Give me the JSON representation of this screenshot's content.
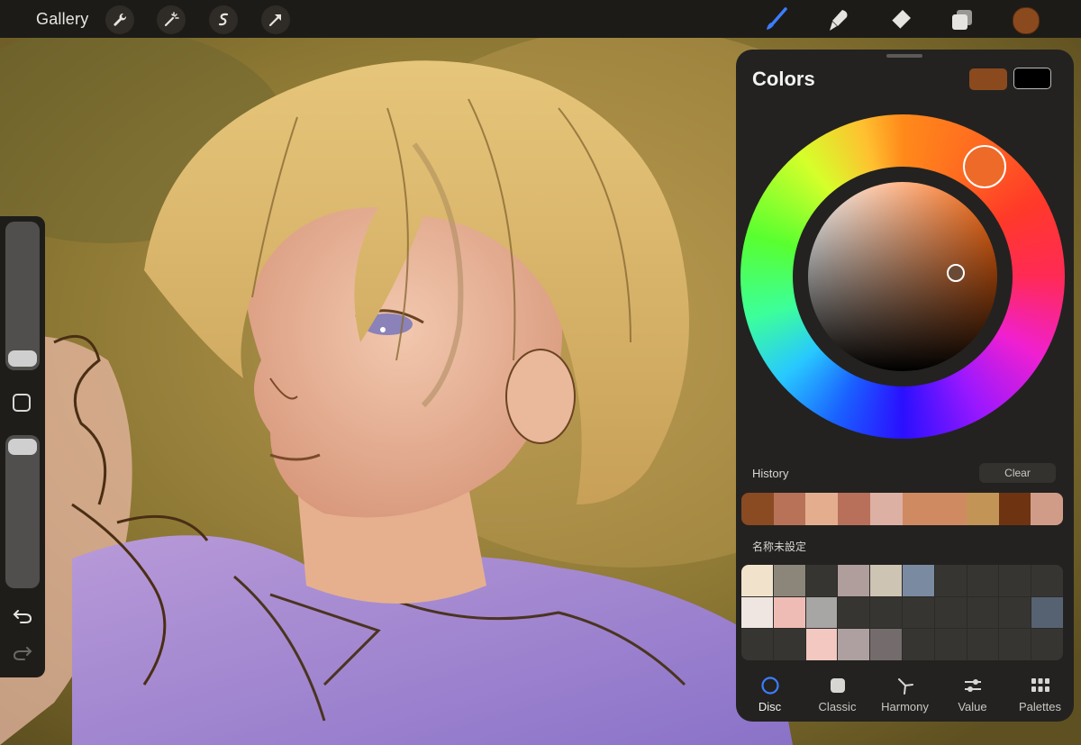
{
  "app": {
    "gallery_label": "Gallery"
  },
  "toolbar": {
    "left_tools": [
      "wrench-icon",
      "magic-wand-icon",
      "selection-s-icon",
      "transform-arrow-icon"
    ],
    "right_tools": [
      "brush-icon",
      "smudge-icon",
      "eraser-icon",
      "layers-icon"
    ],
    "current_color": "#8b4a1e"
  },
  "panel": {
    "title": "Colors",
    "primary_color": "#8b4a1e",
    "secondary_color": "#000000",
    "history_label": "History",
    "clear_label": "Clear",
    "history_colors": [
      "#8a4a22",
      "#b87258",
      "#e4ae8e",
      "#b8705a",
      "#dcb0a2",
      "#d08a62",
      "#d08a62",
      "#c29456",
      "#6e3412",
      "#d09c88"
    ],
    "palette_label": "名称未設定",
    "palette_colors": [
      "#f1e3cb",
      "#8c857a",
      "#363532",
      "#b09e9c",
      "#cdc4b4",
      "#7a8aa0",
      "#363532",
      "#363532",
      "#363532",
      "#363532",
      "#efe6e2",
      "#eebcb4",
      "#a8a6a4",
      "#363532",
      "#363532",
      "#363532",
      "#363532",
      "#363532",
      "#363532",
      "#566272",
      "#363532",
      "#363532",
      "#f2c8c0",
      "#aea0a0",
      "#746c6c",
      "#363532",
      "#363532",
      "#363532",
      "#363532",
      "#363532"
    ],
    "tabs": [
      {
        "label": "Disc",
        "icon": "disc-icon",
        "active": true
      },
      {
        "label": "Classic",
        "icon": "classic-square-icon",
        "active": false
      },
      {
        "label": "Harmony",
        "icon": "harmony-icon",
        "active": false
      },
      {
        "label": "Value",
        "icon": "value-sliders-icon",
        "active": false
      },
      {
        "label": "Palettes",
        "icon": "palettes-grid-icon",
        "active": false
      }
    ]
  }
}
